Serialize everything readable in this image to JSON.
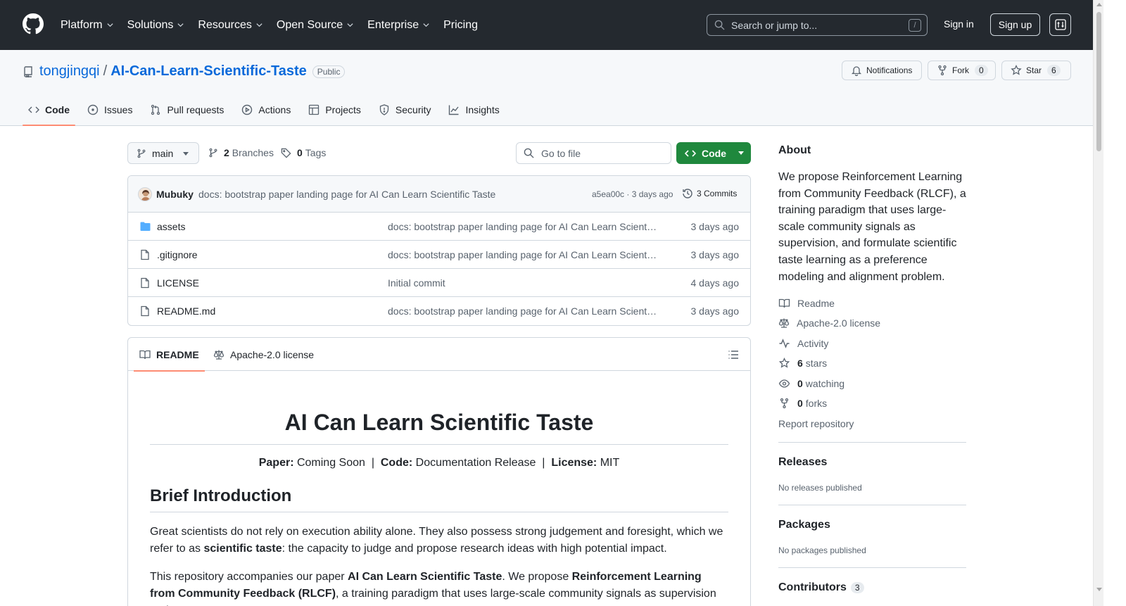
{
  "header": {
    "nav": [
      "Platform",
      "Solutions",
      "Resources",
      "Open Source",
      "Enterprise",
      "Pricing"
    ],
    "search_placeholder": "Search or jump to...",
    "search_shortcut": "/",
    "sign_in": "Sign in",
    "sign_up": "Sign up"
  },
  "repo": {
    "owner": "tongjingqi",
    "separator": "/",
    "name": "AI-Can-Learn-Scientific-Taste",
    "visibility": "Public",
    "notifications_label": "Notifications",
    "fork_label": "Fork",
    "fork_count": "0",
    "star_label": "Star",
    "star_count": "6",
    "tabs": [
      "Code",
      "Issues",
      "Pull requests",
      "Actions",
      "Projects",
      "Security",
      "Insights"
    ]
  },
  "toolbar": {
    "branch": "main",
    "branches_count": "2",
    "branches_label": "Branches",
    "tags_count": "0",
    "tags_label": "Tags",
    "goto_placeholder": "Go to file",
    "code_label": "Code"
  },
  "commit": {
    "author": "Mubuky",
    "message": "docs: bootstrap paper landing page for AI Can Learn Scientific Taste",
    "hash_age": "a5ea00c · 3 days ago",
    "count_label": "3 Commits"
  },
  "files": [
    {
      "name": "assets",
      "type": "folder",
      "message": "docs: bootstrap paper landing page for AI Can Learn Scientific Taste",
      "age": "3 days ago"
    },
    {
      "name": ".gitignore",
      "type": "file",
      "message": "docs: bootstrap paper landing page for AI Can Learn Scientific Taste",
      "age": "3 days ago"
    },
    {
      "name": "LICENSE",
      "type": "file",
      "message": "Initial commit",
      "age": "4 days ago"
    },
    {
      "name": "README.md",
      "type": "file",
      "message": "docs: bootstrap paper landing page for AI Can Learn Scientific Taste",
      "age": "3 days ago"
    }
  ],
  "readme": {
    "tab_readme": "README",
    "tab_license": "Apache-2.0 license",
    "title": "AI Can Learn Scientific Taste",
    "meta_paper_label": "Paper:",
    "meta_paper_value": "Coming Soon",
    "meta_code_label": "Code:",
    "meta_code_value": "Documentation Release",
    "meta_license_label": "License:",
    "meta_license_value": "MIT",
    "meta_sep": "|",
    "h2_intro": "Brief Introduction",
    "p1_a": "Great scientists do not rely on execution ability alone. They also possess strong judgement and foresight, which we refer to as ",
    "p1_b": "scientific taste",
    "p1_c": ": the capacity to judge and propose research ideas with high potential impact.",
    "p2_a": "This repository accompanies our paper ",
    "p2_b": "AI Can Learn Scientific Taste",
    "p2_c": ". We propose ",
    "p2_d": "Reinforcement Learning from Community Feedback (RLCF)",
    "p2_e": ", a training paradigm that uses large-scale community signals as supervision and"
  },
  "sidebar": {
    "about_title": "About",
    "about_text": "We propose Reinforcement Learning from Community Feedback (RLCF), a training paradigm that uses large-scale community signals as supervision, and formulate scientific taste learning as a preference modeling and alignment problem.",
    "readme": "Readme",
    "license": "Apache-2.0 license",
    "activity": "Activity",
    "stars_count": "6",
    "stars_label": "stars",
    "watching_count": "0",
    "watching_label": "watching",
    "forks_count": "0",
    "forks_label": "forks",
    "report": "Report repository",
    "releases_title": "Releases",
    "releases_text": "No releases published",
    "packages_title": "Packages",
    "packages_text": "No packages published",
    "contributors_title": "Contributors",
    "contributors_count": "3"
  },
  "colors": {
    "header_bg": "#24292f",
    "link": "#0969da",
    "code_button": "#1f883d",
    "active_tab_underline": "#fd8c73"
  }
}
